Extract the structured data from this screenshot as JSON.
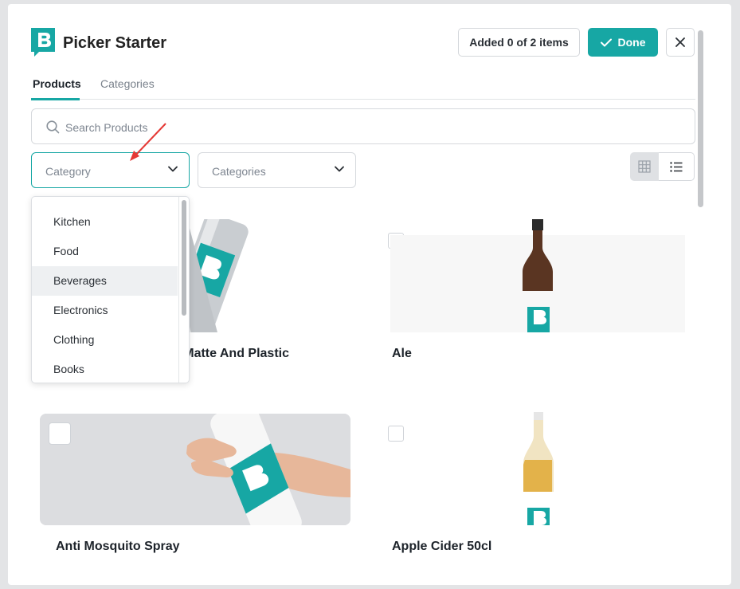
{
  "app": {
    "title": "Picker Starter"
  },
  "header": {
    "added_label": "Added 0 of 2 items",
    "done_label": "Done"
  },
  "tabs": [
    {
      "label": "Products"
    },
    {
      "label": "Categories"
    }
  ],
  "search": {
    "placeholder": "Search Products"
  },
  "filters": {
    "category_placeholder": "Category",
    "categories_placeholder": "Categories"
  },
  "dropdown": {
    "items": [
      {
        "label": "Kitchen"
      },
      {
        "label": "Food"
      },
      {
        "label": "Beverages"
      },
      {
        "label": "Electronics"
      },
      {
        "label": "Clothing"
      },
      {
        "label": "Books"
      }
    ],
    "highlighted": "Beverages"
  },
  "products": [
    {
      "name": "lic Matte And Plastic"
    },
    {
      "name": "Ale"
    },
    {
      "name": "Anti Mosquito Spray"
    },
    {
      "name": "Apple Cider 50cl"
    }
  ],
  "colors": {
    "accent": "#17a7a4",
    "annotation_arrow": "#e53935"
  }
}
